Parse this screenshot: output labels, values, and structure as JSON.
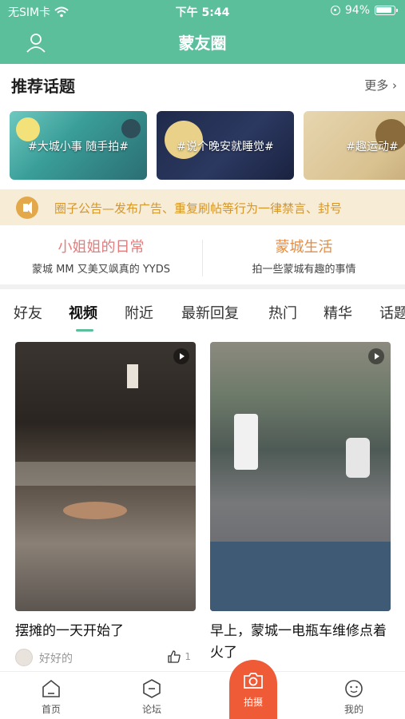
{
  "status_bar": {
    "carrier": "无SIM卡",
    "time": "下午 5:44",
    "battery": "94%"
  },
  "header": {
    "title": "蒙友圈"
  },
  "recommended": {
    "title": "推荐话题",
    "more": "更多",
    "topics": [
      {
        "label": "#大城小事 随手拍#"
      },
      {
        "label": "#说个晚安就睡觉#"
      },
      {
        "label": "#趣运动#"
      }
    ]
  },
  "notice": {
    "text": "圈子公告—发布广告、重复刷帖等行为一律禁言、封号"
  },
  "circles": [
    {
      "name": "小姐姐的日常",
      "desc": "蒙城 MM 又美又飒真的 YYDS",
      "color": "#e57b7b"
    },
    {
      "name": "蒙城生活",
      "desc": "拍一些蒙城有趣的事情",
      "color": "#e78b3e"
    }
  ],
  "tabs": [
    "好友",
    "视频",
    "附近",
    "最新回复",
    "热门",
    "精华",
    "话题"
  ],
  "active_tab": "视频",
  "feed": [
    {
      "title": "摆摊的一天开始了",
      "author": "好好的",
      "likes": "1"
    },
    {
      "title": "早上，蒙城一电瓶车维修点着火了"
    }
  ],
  "bottom_nav": {
    "home": "首页",
    "forum": "论坛",
    "capture": "拍摄",
    "mine": "我的"
  },
  "colors": {
    "brand": "#5cbf9c",
    "accent": "#ef5a37",
    "notice": "#d79628"
  }
}
